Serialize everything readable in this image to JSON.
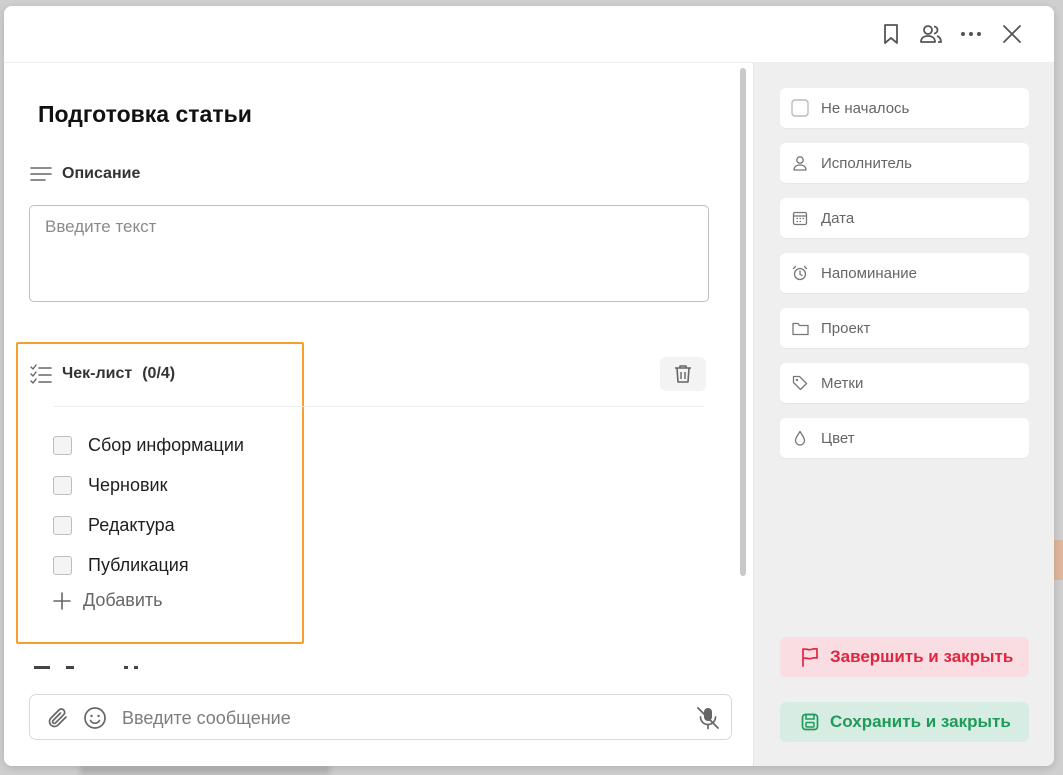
{
  "task": {
    "title": "Подготовка статьи"
  },
  "description": {
    "heading": "Описание",
    "placeholder": "Введите текст"
  },
  "checklist": {
    "heading": "Чек-лист",
    "count": "(0/4)",
    "items": [
      {
        "label": "Сбор информации",
        "checked": false
      },
      {
        "label": "Черновик",
        "checked": false
      },
      {
        "label": "Редактура",
        "checked": false
      },
      {
        "label": "Публикация",
        "checked": false
      }
    ],
    "add_label": "Добавить",
    "highlight_color": "#f6a02b"
  },
  "message": {
    "placeholder": "Введите сообщение"
  },
  "topbar": {
    "icons": [
      "bookmark-icon",
      "users-icon",
      "more-icon",
      "close-icon"
    ]
  },
  "properties": {
    "status": "Не началось",
    "assignee": "Исполнитель",
    "date": "Дата",
    "reminder": "Напоминание",
    "project": "Проект",
    "tags": "Метки",
    "color": "Цвет"
  },
  "actions": {
    "finish_label": "Завершить и закрыть",
    "save_label": "Сохранить и закрыть",
    "finish_color": "#e0263f",
    "save_color": "#1f9b5a"
  }
}
